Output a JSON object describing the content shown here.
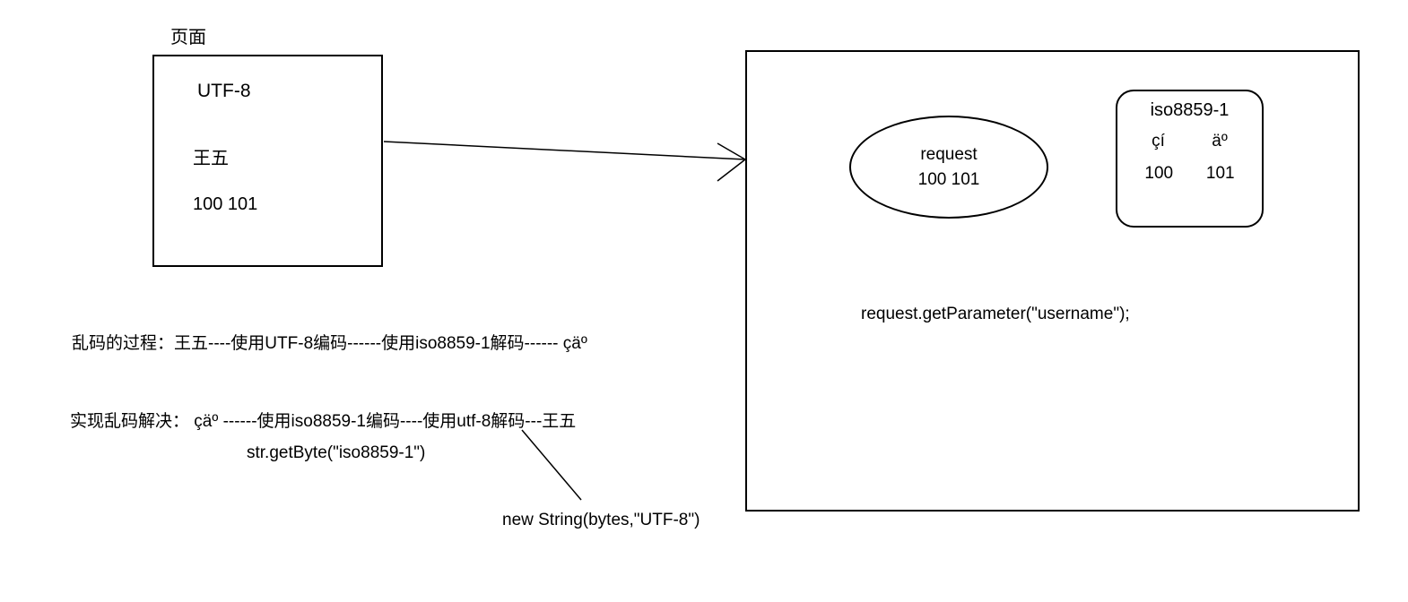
{
  "page_label": "页面",
  "left_box": {
    "encoding": "UTF-8",
    "name": "王五",
    "bytes": "100 101"
  },
  "explanation": {
    "line1": "乱码的过程：王五----使用UTF-8编码------使用iso8859-1解码------ çäº",
    "line2": "实现乱码解决： çäº   ------使用iso8859-1编码----使用utf-8解码---王五",
    "line2b": "str.getByte(\"iso8859-1\")",
    "line3": "new String(bytes,\"UTF-8\")"
  },
  "server": {
    "request_label": "request",
    "request_bytes": "100 101",
    "iso_title": "iso8859-1",
    "iso_garbled": [
      "çí",
      "äº"
    ],
    "iso_codes": [
      "100",
      "101"
    ],
    "get_param": "request.getParameter(\"username\");"
  }
}
